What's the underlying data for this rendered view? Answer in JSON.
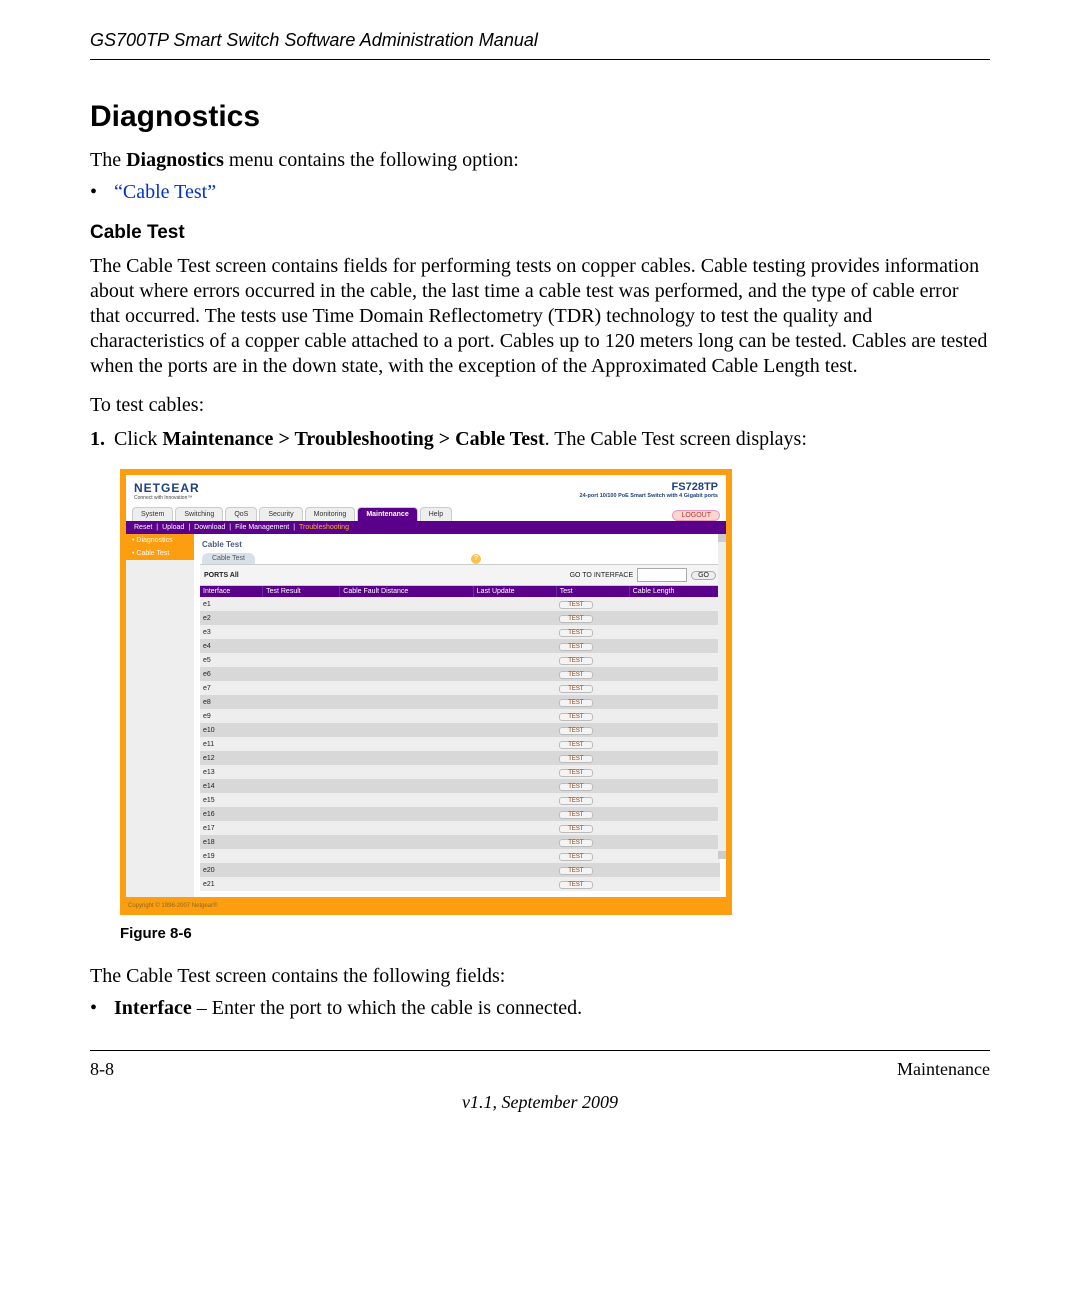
{
  "doc": {
    "header": "GS700TP Smart Switch Software Administration Manual",
    "title": "Diagnostics",
    "intro_pre": "The ",
    "intro_bold": "Diagnostics",
    "intro_post": " menu contains the following option:",
    "bullet_link": "“Cable Test”",
    "subhead": "Cable Test",
    "para1": "The Cable Test screen contains fields for performing tests on copper cables. Cable testing provides information about where errors occurred in the cable, the last time a cable test was performed, and the type of cable error that occurred. The tests use Time Domain Reflectometry (TDR) technology to test the quality and characteristics of a copper cable attached to a port. Cables up to 120 meters long can be tested. Cables are tested when the ports are in the down state, with the exception of the Approximated Cable Length test.",
    "para2": "To test cables:",
    "step1_pre": "Click ",
    "step1_bold": "Maintenance > Troubleshooting > Cable Test",
    "step1_post": ". The Cable Test screen displays:",
    "figure_label": "Figure 8-6",
    "after1": "The Cable Test screen contains the following fields:",
    "after2_bold": "Interface",
    "after2_rest": " – Enter the port to which the cable is connected.",
    "footer_left": "8-8",
    "footer_right": "Maintenance",
    "footer_version": "v1.1, September 2009"
  },
  "app": {
    "brand": "NETGEAR",
    "brand_tag": "Connect with Innovation™",
    "model": "FS728TP",
    "model_desc": "24-port 10/100 PoE Smart Switch with 4 Gigabit ports",
    "tabs": [
      "System",
      "Switching",
      "QoS",
      "Security",
      "Monitoring",
      "Maintenance",
      "Help"
    ],
    "active_tab": 5,
    "logout": "LOGOUT",
    "subnav": [
      "Reset",
      "Upload",
      "Download",
      "File Management",
      "Troubleshooting"
    ],
    "subnav_active": 4,
    "sidebar": [
      {
        "label": "Diagnostics",
        "hl": true
      },
      {
        "label": "Cable Test",
        "hl": true
      }
    ],
    "panel_title": "Cable Test",
    "sub_tab": "Cable Test",
    "help": "?",
    "ports_label": "PORTS All",
    "goto_label": "GO TO INTERFACE",
    "go_btn": "GO",
    "columns": [
      "Interface",
      "Test Result",
      "Cable Fault Distance",
      "Last Update",
      "Test",
      "Cable Length"
    ],
    "rows": [
      "e1",
      "e2",
      "e3",
      "e4",
      "e5",
      "e6",
      "e7",
      "e8",
      "e9",
      "e10",
      "e11",
      "e12",
      "e13",
      "e14",
      "e15",
      "e16",
      "e17",
      "e18",
      "e19",
      "e20",
      "e21"
    ],
    "test_btn": "TEST",
    "copyright": "Copyright © 1996-2007 Netgear®"
  }
}
